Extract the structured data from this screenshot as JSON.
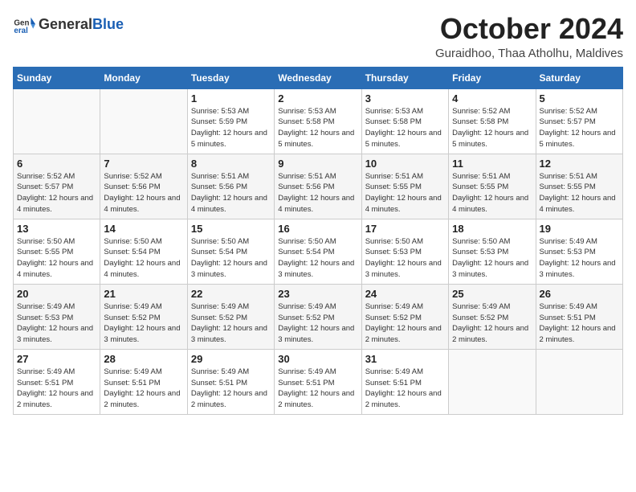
{
  "header": {
    "logo": {
      "text_general": "General",
      "text_blue": "Blue"
    },
    "title": "October 2024",
    "subtitle": "Guraidhoo, Thaa Atholhu, Maldives"
  },
  "days_of_week": [
    "Sunday",
    "Monday",
    "Tuesday",
    "Wednesday",
    "Thursday",
    "Friday",
    "Saturday"
  ],
  "weeks": [
    [
      {
        "day": null,
        "info": null
      },
      {
        "day": null,
        "info": null
      },
      {
        "day": "1",
        "info": "Sunrise: 5:53 AM\nSunset: 5:59 PM\nDaylight: 12 hours\nand 5 minutes."
      },
      {
        "day": "2",
        "info": "Sunrise: 5:53 AM\nSunset: 5:58 PM\nDaylight: 12 hours\nand 5 minutes."
      },
      {
        "day": "3",
        "info": "Sunrise: 5:53 AM\nSunset: 5:58 PM\nDaylight: 12 hours\nand 5 minutes."
      },
      {
        "day": "4",
        "info": "Sunrise: 5:52 AM\nSunset: 5:58 PM\nDaylight: 12 hours\nand 5 minutes."
      },
      {
        "day": "5",
        "info": "Sunrise: 5:52 AM\nSunset: 5:57 PM\nDaylight: 12 hours\nand 5 minutes."
      }
    ],
    [
      {
        "day": "6",
        "info": "Sunrise: 5:52 AM\nSunset: 5:57 PM\nDaylight: 12 hours\nand 4 minutes."
      },
      {
        "day": "7",
        "info": "Sunrise: 5:52 AM\nSunset: 5:56 PM\nDaylight: 12 hours\nand 4 minutes."
      },
      {
        "day": "8",
        "info": "Sunrise: 5:51 AM\nSunset: 5:56 PM\nDaylight: 12 hours\nand 4 minutes."
      },
      {
        "day": "9",
        "info": "Sunrise: 5:51 AM\nSunset: 5:56 PM\nDaylight: 12 hours\nand 4 minutes."
      },
      {
        "day": "10",
        "info": "Sunrise: 5:51 AM\nSunset: 5:55 PM\nDaylight: 12 hours\nand 4 minutes."
      },
      {
        "day": "11",
        "info": "Sunrise: 5:51 AM\nSunset: 5:55 PM\nDaylight: 12 hours\nand 4 minutes."
      },
      {
        "day": "12",
        "info": "Sunrise: 5:51 AM\nSunset: 5:55 PM\nDaylight: 12 hours\nand 4 minutes."
      }
    ],
    [
      {
        "day": "13",
        "info": "Sunrise: 5:50 AM\nSunset: 5:55 PM\nDaylight: 12 hours\nand 4 minutes."
      },
      {
        "day": "14",
        "info": "Sunrise: 5:50 AM\nSunset: 5:54 PM\nDaylight: 12 hours\nand 4 minutes."
      },
      {
        "day": "15",
        "info": "Sunrise: 5:50 AM\nSunset: 5:54 PM\nDaylight: 12 hours\nand 3 minutes."
      },
      {
        "day": "16",
        "info": "Sunrise: 5:50 AM\nSunset: 5:54 PM\nDaylight: 12 hours\nand 3 minutes."
      },
      {
        "day": "17",
        "info": "Sunrise: 5:50 AM\nSunset: 5:53 PM\nDaylight: 12 hours\nand 3 minutes."
      },
      {
        "day": "18",
        "info": "Sunrise: 5:50 AM\nSunset: 5:53 PM\nDaylight: 12 hours\nand 3 minutes."
      },
      {
        "day": "19",
        "info": "Sunrise: 5:49 AM\nSunset: 5:53 PM\nDaylight: 12 hours\nand 3 minutes."
      }
    ],
    [
      {
        "day": "20",
        "info": "Sunrise: 5:49 AM\nSunset: 5:53 PM\nDaylight: 12 hours\nand 3 minutes."
      },
      {
        "day": "21",
        "info": "Sunrise: 5:49 AM\nSunset: 5:52 PM\nDaylight: 12 hours\nand 3 minutes."
      },
      {
        "day": "22",
        "info": "Sunrise: 5:49 AM\nSunset: 5:52 PM\nDaylight: 12 hours\nand 3 minutes."
      },
      {
        "day": "23",
        "info": "Sunrise: 5:49 AM\nSunset: 5:52 PM\nDaylight: 12 hours\nand 3 minutes."
      },
      {
        "day": "24",
        "info": "Sunrise: 5:49 AM\nSunset: 5:52 PM\nDaylight: 12 hours\nand 2 minutes."
      },
      {
        "day": "25",
        "info": "Sunrise: 5:49 AM\nSunset: 5:52 PM\nDaylight: 12 hours\nand 2 minutes."
      },
      {
        "day": "26",
        "info": "Sunrise: 5:49 AM\nSunset: 5:51 PM\nDaylight: 12 hours\nand 2 minutes."
      }
    ],
    [
      {
        "day": "27",
        "info": "Sunrise: 5:49 AM\nSunset: 5:51 PM\nDaylight: 12 hours\nand 2 minutes."
      },
      {
        "day": "28",
        "info": "Sunrise: 5:49 AM\nSunset: 5:51 PM\nDaylight: 12 hours\nand 2 minutes."
      },
      {
        "day": "29",
        "info": "Sunrise: 5:49 AM\nSunset: 5:51 PM\nDaylight: 12 hours\nand 2 minutes."
      },
      {
        "day": "30",
        "info": "Sunrise: 5:49 AM\nSunset: 5:51 PM\nDaylight: 12 hours\nand 2 minutes."
      },
      {
        "day": "31",
        "info": "Sunrise: 5:49 AM\nSunset: 5:51 PM\nDaylight: 12 hours\nand 2 minutes."
      },
      {
        "day": null,
        "info": null
      },
      {
        "day": null,
        "info": null
      }
    ]
  ]
}
